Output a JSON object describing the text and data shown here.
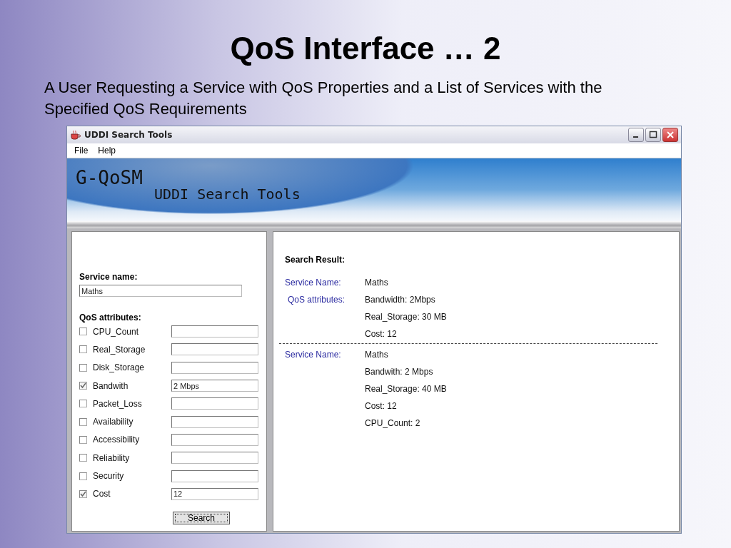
{
  "slide": {
    "title": "QoS Interface … 2",
    "subtitle": "A User Requesting a Service with QoS Properties and a List of Services with the Specified QoS Requirements"
  },
  "window": {
    "title": "UDDI Search Tools"
  },
  "menu": [
    "File",
    "Help"
  ],
  "banner": {
    "logo": "G-QoSM",
    "subtitle": "UDDI Search Tools"
  },
  "search_form": {
    "service_label": "Service name:",
    "service_value": "Maths",
    "qos_label": "QoS attributes:",
    "attributes": [
      {
        "label": "CPU_Count",
        "checked": false
      },
      {
        "label": "Real_Storage",
        "checked": false
      },
      {
        "label": "Disk_Storage",
        "checked": false
      },
      {
        "label": "Bandwith",
        "checked": true,
        "value": "2 Mbps"
      },
      {
        "label": "Packet_Loss",
        "checked": false
      },
      {
        "label": "Availability",
        "checked": false
      },
      {
        "label": "Accessibility",
        "checked": false
      },
      {
        "label": "Reliability",
        "checked": false
      },
      {
        "label": "Security",
        "checked": false
      },
      {
        "label": "Cost",
        "checked": true,
        "value": "12"
      }
    ],
    "button": "Search"
  },
  "results": {
    "heading": "Search Result:",
    "items": [
      {
        "name_label": "Service Name:",
        "name": "Maths",
        "qos_label": "QoS attributes:",
        "attributes": [
          "Bandwidth:  2Mbps",
          "Real_Storage:  30 MB",
          "Cost: 12"
        ]
      },
      {
        "name_label": "Service Name:",
        "name": "Maths",
        "attributes": [
          "Bandwith: 2 Mbps",
          "Real_Storage: 40 MB",
          "Cost: 12",
          "CPU_Count: 2"
        ]
      }
    ]
  }
}
